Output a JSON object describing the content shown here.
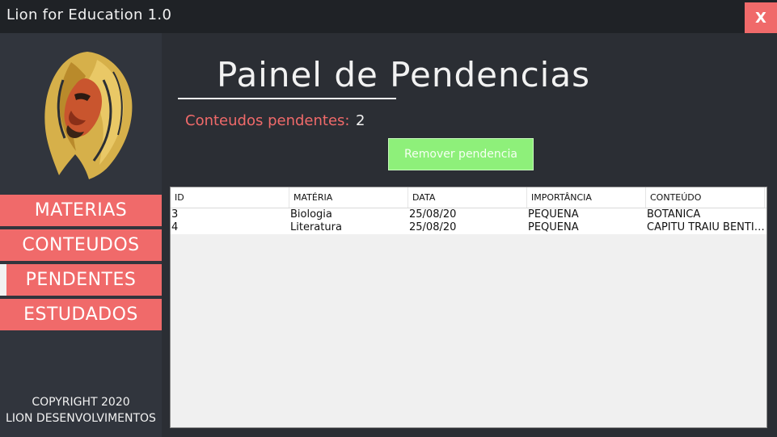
{
  "window": {
    "title": "Lion for Education 1.0",
    "close_label": "X"
  },
  "sidebar": {
    "items": [
      {
        "label": "MATERIAS"
      },
      {
        "label": "CONTEUDOS"
      },
      {
        "label": "PENDENTES"
      },
      {
        "label": "ESTUDADOS"
      }
    ],
    "active_index": 2,
    "copyright_line1": "COPYRIGHT 2020",
    "copyright_line2": "LION DESENVOLVIMENTOS"
  },
  "main": {
    "title": "Painel de Pendencias",
    "pending_label": "Conteudos pendentes:",
    "pending_count": "2",
    "remove_button_label": "Remover pendencia"
  },
  "table": {
    "columns": [
      "ID",
      "MATÉRIA",
      "DATA",
      "IMPORTÂNCIA",
      "CONTEÚDO"
    ],
    "rows": [
      [
        "3",
        "Biologia",
        "25/08/20",
        "PEQUENA",
        "BOTANICA"
      ],
      [
        "4",
        "Literatura",
        "25/08/20",
        "PEQUENA",
        "CAPITU TRAIU BENTINHO"
      ]
    ]
  },
  "colors": {
    "accent": "#f06a6a",
    "button_green": "#8ef07a",
    "background": "#2b2e34",
    "sidebar": "#31353d"
  },
  "icons": {
    "logo": "lion-logo-icon"
  }
}
